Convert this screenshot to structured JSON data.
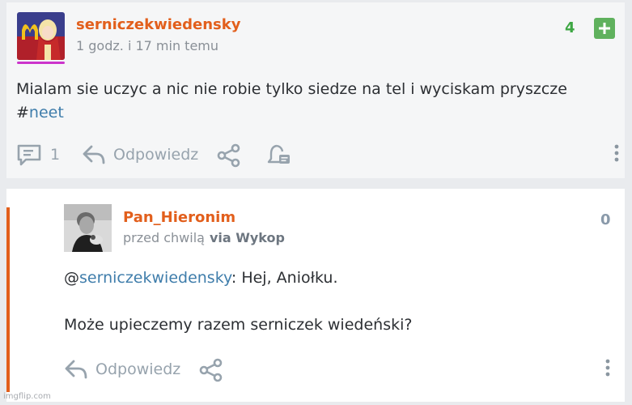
{
  "post": {
    "author": "serniczekwiedensky",
    "time": "1 godz. i 17 min temu",
    "votes": "4",
    "plus_icon": "plus-icon",
    "body_text": "Mialam sie uczyc a nic nie robie tylko siedze na tel i wyciskam pryszcze",
    "hash": "#",
    "tag": "neet",
    "comment_count": "1",
    "reply_label": "Odpowiedz",
    "icons": [
      "comments-icon",
      "reply-arrow-icon",
      "share-icon",
      "notify-bell-icon",
      "more-vertical-icon"
    ]
  },
  "comment": {
    "author": "Pan_Hieronim",
    "time": "przed chwilą",
    "via": "via Wykop",
    "votes": "0",
    "mention_prefix": "@",
    "mention": "serniczekwiedensky",
    "line1_rest": ": Hej, Aniołku.",
    "line2": "Może upieczemy razem serniczek wiedeński?",
    "reply_label": "Odpowiedz",
    "icons": [
      "reply-arrow-icon",
      "share-icon",
      "more-vertical-icon"
    ]
  },
  "watermark": "imgflip.com",
  "colors": {
    "author": "#e25f1c",
    "votes_positive": "#3ea744",
    "plus_button": "#5fb15d",
    "link": "#3f7dab",
    "action_gray": "#97a3ad",
    "accent_bar": "#e25f1c"
  }
}
